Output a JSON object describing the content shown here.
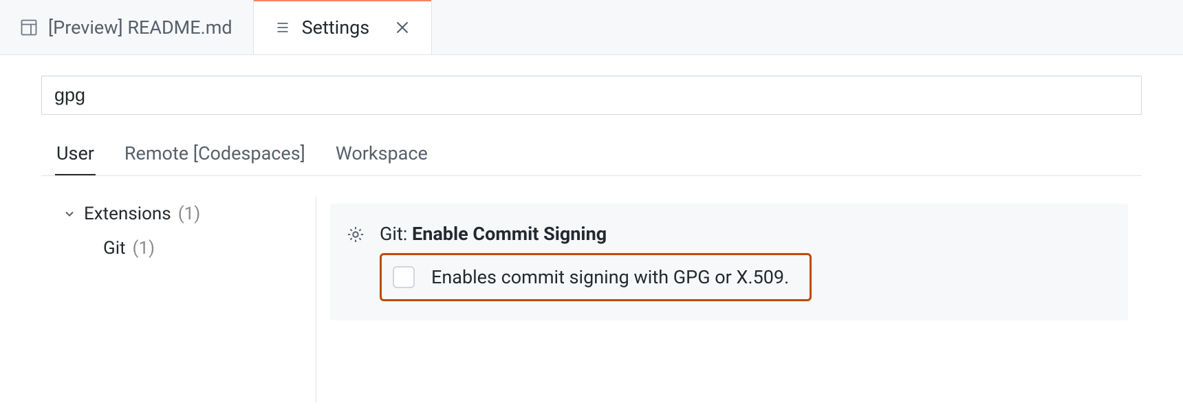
{
  "tabs": [
    {
      "label": "[Preview] README.md",
      "active": false
    },
    {
      "label": "Settings",
      "active": true
    }
  ],
  "search": {
    "value": "gpg"
  },
  "scopes": [
    {
      "label": "User"
    },
    {
      "label": "Remote [Codespaces]"
    },
    {
      "label": "Workspace"
    }
  ],
  "sidebar": {
    "group": {
      "label": "Extensions",
      "count": "(1)"
    },
    "child": {
      "label": "Git",
      "count": "(1)"
    }
  },
  "setting": {
    "prefix": "Git: ",
    "title": "Enable Commit Signing",
    "description": "Enables commit signing with GPG or X.509."
  }
}
